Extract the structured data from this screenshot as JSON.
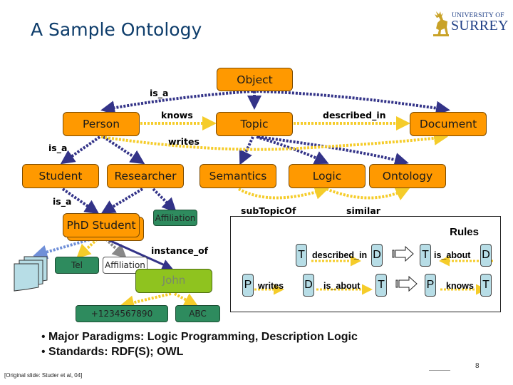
{
  "slide": {
    "title": "A Sample Ontology",
    "logo": {
      "line1": "UNIVERSITY OF",
      "line2": "SURREY",
      "icon": "stag-icon"
    },
    "page_number": "8",
    "footer": "[Original slide: Studer et al, 04]"
  },
  "diagram": {
    "concepts": {
      "object": "Object",
      "person": "Person",
      "topic": "Topic",
      "document": "Document",
      "student": "Student",
      "researcher": "Researcher",
      "semantics": "Semantics",
      "logic": "Logic",
      "ontology": "Ontology",
      "phd_student": "PhD Student"
    },
    "attributes": {
      "affiliation_top": "Affiliation",
      "tel": "Tel",
      "affiliation_inst": "Affiliation",
      "phone": "+1234567890",
      "abc": "ABC"
    },
    "instance": "John",
    "relations": {
      "is_a_top": "is_a",
      "is_a_left": "is_a",
      "is_a_phd": "is_a",
      "knows": "knows",
      "writes": "writes",
      "described_in": "described_in",
      "sub_topic_of": "subTopicOf",
      "similar": "similar",
      "instance_of": "instance_of"
    },
    "colors": {
      "concept": "#ff9900",
      "attribute": "#2e8b5e",
      "instance": "#8fc31f",
      "is_a_edge": "#333388",
      "relation_edge": "#f5cc2a"
    }
  },
  "rules": {
    "title": "Rules",
    "rule1": {
      "lhs": [
        {
          "box": "T"
        },
        {
          "label": "described_in"
        },
        {
          "box": "D"
        }
      ],
      "rhs": [
        {
          "box": "T"
        },
        {
          "label": "is_about"
        },
        {
          "box": "D"
        }
      ]
    },
    "rule2": {
      "lhs": [
        {
          "box": "P"
        },
        {
          "label": "writes"
        },
        {
          "box": "D"
        },
        {
          "label": "is_about"
        },
        {
          "box": "T"
        }
      ],
      "rhs": [
        {
          "box": "P"
        },
        {
          "label": "knows"
        },
        {
          "box": "T"
        }
      ]
    }
  },
  "bullets": [
    "Major Paradigms: Logic Programming, Description Logic",
    "Standards: RDF(S); OWL"
  ]
}
